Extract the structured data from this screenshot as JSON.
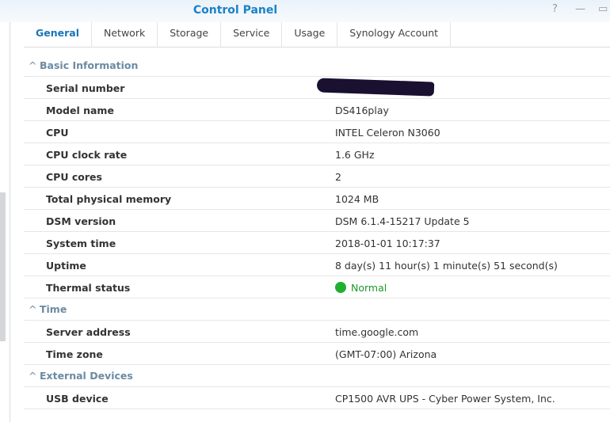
{
  "window": {
    "title": "Control Panel",
    "help": "?",
    "minimize": "—",
    "maximize": "▭"
  },
  "tabs": [
    "General",
    "Network",
    "Storage",
    "Service",
    "Usage",
    "Synology Account"
  ],
  "sections": [
    {
      "title": "Basic Information",
      "rows": [
        {
          "label": "Serial number",
          "value": ""
        },
        {
          "label": "Model name",
          "value": "DS416play"
        },
        {
          "label": "CPU",
          "value": "INTEL Celeron N3060"
        },
        {
          "label": "CPU clock rate",
          "value": "1.6 GHz"
        },
        {
          "label": "CPU cores",
          "value": "2"
        },
        {
          "label": "Total physical memory",
          "value": "1024 MB"
        },
        {
          "label": "DSM version",
          "value": "DSM 6.1.4-15217 Update 5"
        },
        {
          "label": "System time",
          "value": "2018-01-01 10:17:37"
        },
        {
          "label": "Uptime",
          "value": "8 day(s) 11 hour(s) 1 minute(s) 51 second(s)"
        },
        {
          "label": "Thermal status",
          "value": "Normal"
        }
      ]
    },
    {
      "title": "Time",
      "rows": [
        {
          "label": "Server address",
          "value": "time.google.com"
        },
        {
          "label": "Time zone",
          "value": "(GMT-07:00) Arizona"
        }
      ]
    },
    {
      "title": "External Devices",
      "rows": [
        {
          "label": "USB device",
          "value": "CP1500 AVR UPS - Cyber Power System, Inc."
        }
      ]
    }
  ]
}
